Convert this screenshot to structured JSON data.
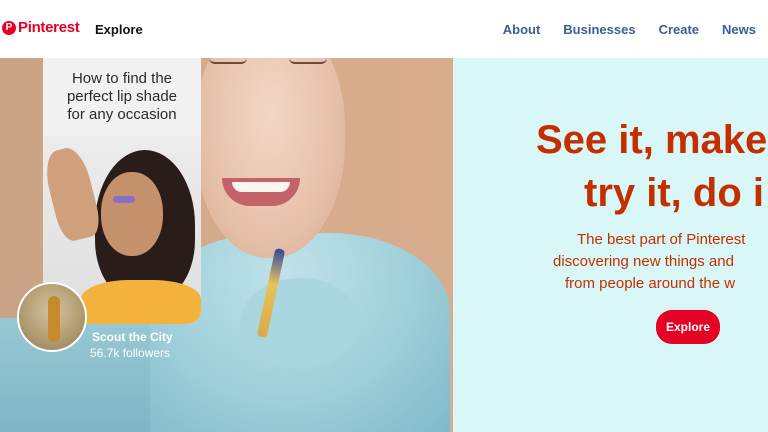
{
  "header": {
    "logo_text": "Pinterest",
    "logo_mark": "P",
    "explore_label": "Explore",
    "nav": [
      {
        "label": "About"
      },
      {
        "label": "Businesses"
      },
      {
        "label": "Create"
      },
      {
        "label": "News"
      }
    ]
  },
  "hero": {
    "pin": {
      "title_lines": [
        "How to find the",
        "perfect lip shade",
        "for any occasion"
      ],
      "creator_name": "Scout the City",
      "creator_followers": "56.7k followers"
    },
    "headline_lines": [
      "See it, make",
      "try it, do i"
    ],
    "subtext_lines": [
      "The best part of Pinterest",
      "discovering new things and",
      "from people around the w"
    ],
    "cta_label": "Explore"
  },
  "colors": {
    "brand_red": "#e60023",
    "headline": "#c32f00",
    "nav_link": "#3a5f98",
    "hero_right_bg": "#daf7f7"
  }
}
